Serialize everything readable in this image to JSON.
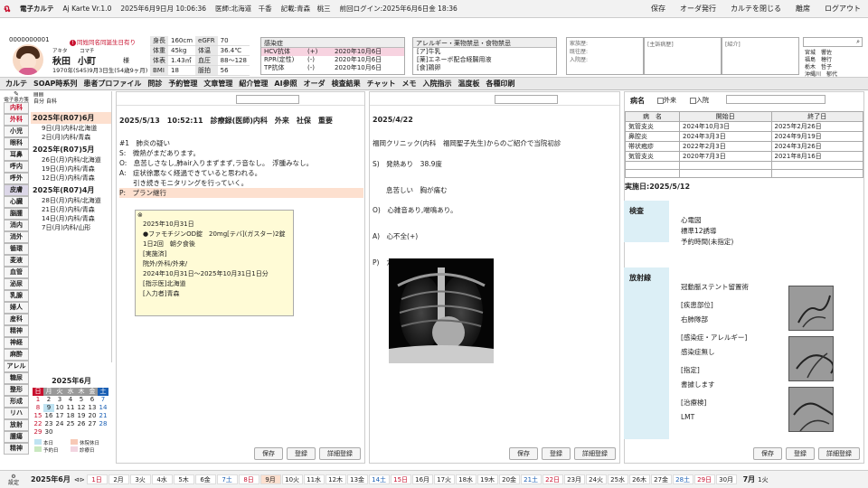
{
  "topbar": {
    "app_name": "電子カルテ",
    "version": "Aj Karte Vr.1.0",
    "datetime": "2025年6月9日月 10:06:36",
    "doctor": "医師:北海道　千香",
    "recorder": "記載:青森　桃三",
    "last_login": "前回ログイン:2025年6月6日金 18:36",
    "zoom": "100%",
    "help": "操作",
    "menu": [
      "保存",
      "オーダ発行",
      "カルテを閉じる",
      "離席",
      "ログアウト"
    ]
  },
  "patient": {
    "id": "0000000001",
    "alert": "同姓同名同誕生日有り",
    "kana_last": "アキタ",
    "kana_first": "コマチ",
    "name_last": "秋田",
    "name_first": "小町",
    "honorific": "様",
    "birth": "1970年(S45)9月3日生(54歳9ヶ月)",
    "sex_symbol": "女",
    "vitals": [
      [
        "身長",
        "160cm",
        "eGFR",
        "70"
      ],
      [
        "体重",
        "45kg",
        "体温",
        "36.4℃"
      ],
      [
        "体表",
        "1.43㎡",
        "血圧",
        "88～128"
      ],
      [
        "BMI",
        "18",
        "脈拍",
        "56"
      ]
    ]
  },
  "infection": {
    "title": "感染症",
    "rows": [
      [
        "HCV抗体",
        "(+)",
        "2020年10月6日"
      ],
      [
        "RPR(定性)",
        "(-)",
        "2020年10月6日"
      ],
      [
        "TP抗体",
        "(-)",
        "2020年10月6日"
      ]
    ]
  },
  "allergy": {
    "title": "アレルギー・薬物禁忌・食物禁忌",
    "rows": [
      "[ア]牛乳",
      "[薬]エネーボ配合経腸用液",
      "[食]鶏卵"
    ]
  },
  "history": {
    "labels": [
      "家族歴:",
      "既往歴:",
      "入院歴:"
    ],
    "main_title": "[主訴病歴]",
    "intro_title": "[紹介]"
  },
  "staff": [
    "宮城　響佐",
    "福島　穂行",
    "栃木　哲子",
    "沖縄川　郁代"
  ],
  "tabs": [
    "カルテ",
    "SOAP時系列",
    "患者プロファイル",
    "問診",
    "予約管理",
    "文章管理",
    "紹介管理",
    "AI参照",
    "オーダ",
    "検査結果",
    "チャット",
    "メモ",
    "入院指示",
    "温度板",
    "各種印刷"
  ],
  "leftnav": {
    "header": "電子患方箋",
    "items": [
      "内科",
      "外科",
      "小児",
      "眼科",
      "耳鼻",
      "呼内",
      "呼外",
      "皮膚",
      "心臓",
      "脳腫",
      "消内",
      "消外",
      "循環",
      "麦液",
      "血管",
      "泌尿",
      "乳腺",
      "婦人",
      "産科",
      "精神",
      "神経",
      "麻酔",
      "アレル",
      "糖尿",
      "整形",
      "形成",
      "リハ",
      "放射",
      "腫瘍",
      "精神"
    ],
    "selected": "皮膚"
  },
  "visits": {
    "filters": [
      "自分",
      "自科"
    ],
    "months": [
      {
        "label": "2025年(R07)6月",
        "days": [
          "9日(月)内科/北海道",
          "2日(月)内科/青森"
        ],
        "selected": true
      },
      {
        "label": "2025年(R07)5月",
        "days": [
          "26日(月)内科/北海道",
          "19日(月)内科/青森",
          "12日(月)内科/青森"
        ],
        "selected": false
      },
      {
        "label": "2025年(R07)4月",
        "days": [
          "28日(月)内科/北海道",
          "21日(月)内科/青森",
          "14日(月)内科/青森",
          "7日(月)内科/山形"
        ],
        "selected": false
      }
    ]
  },
  "calendar": {
    "title": "2025年6月",
    "weekdays": [
      "日",
      "月",
      "火",
      "水",
      "木",
      "金",
      "土"
    ],
    "days": [
      "1",
      "2",
      "3",
      "4",
      "5",
      "6",
      "7",
      "8",
      "9",
      "10",
      "11",
      "12",
      "13",
      "14",
      "15",
      "16",
      "17",
      "18",
      "19",
      "20",
      "21",
      "22",
      "23",
      "24",
      "25",
      "26",
      "27",
      "28",
      "29",
      "30"
    ],
    "legend": [
      "本日",
      "休院休日",
      "予約日",
      "診療日"
    ]
  },
  "note1": {
    "header": "2025/5/13　10:52:11　診療録(医師)内科　外来　社保　重要",
    "lines": [
      "#1　肺炎の疑い",
      "S:　微熱がまだあります。",
      "O:　息苦しさなし,肺air入りまずまず,ラ音なし。　浮腫みなし。",
      "A:　症状徐悪なく経過できていると思われる。",
      "　　引き続きモニタリングを行っていく。",
      "P:　プラン継行"
    ],
    "popup": [
      "2025年10月31日",
      "●ファモチジンOD錠　20mg[テバ](ガスター)2錠",
      "1日2回　朝夕食後",
      "[実施済]",
      "院外/外科/外来/",
      "2024年10月31日～2025年10月31日1日分",
      "[指示医]北海道",
      "[入力者]青森"
    ],
    "buttons": [
      "保存",
      "登録",
      "詳細登録"
    ]
  },
  "note2": {
    "header": "2025/4/22",
    "intro": "福岡クリニック(内科　福岡聖子先生)からのご紹介で当院初診",
    "lines": [
      "S)　発熱あり　38.9度",
      "　　息苦しい　胸が痛む",
      "O)　心雑音あり,喘鳴あり。",
      "A)　心不全(+)",
      "P)　カテーテル検査"
    ],
    "buttons": [
      "保存",
      "登録",
      "詳細登録"
    ]
  },
  "disease": {
    "title": "病名",
    "checks": [
      "外来",
      "入院"
    ],
    "headers": [
      "病　名",
      "開始日",
      "終了日"
    ],
    "rows": [
      [
        "気管支炎",
        "2024年10月3日",
        "2025年2月26日"
      ],
      [
        "鼻腔炎",
        "2024年3月3日",
        "2024年9月19日"
      ],
      [
        "帯状疱疹",
        "2022年2月3日",
        "2024年3月26日"
      ],
      [
        "気管支炎",
        "2020年7月3日",
        "2021年8月16日"
      ]
    ]
  },
  "exec": {
    "title": "実施日:2025/5/12",
    "kensa_label": "検査",
    "kensa_items": [
      "心電図",
      "標準12誘導",
      "予約時間(未指定)"
    ],
    "rad_label": "放射線",
    "rad_items": [
      "冠動脈ステント留置術",
      "[疾患部位]",
      "右肺隊部",
      "[感染症・アレルギー]",
      "感染症無し",
      "[指定]",
      "書據します",
      "[治療検]",
      "LMT"
    ],
    "buttons": [
      "保存",
      "登録",
      "詳細登録"
    ]
  },
  "bottom": {
    "month": "2025年6月",
    "days": [
      "1日",
      "2月",
      "3火",
      "4水",
      "5木",
      "6金",
      "7土",
      "8日",
      "9月",
      "10火",
      "11水",
      "12木",
      "13金",
      "14土",
      "15日",
      "16月",
      "17火",
      "18水",
      "19木",
      "20金",
      "21土",
      "22日",
      "23月",
      "24火",
      "25水",
      "26木",
      "27金",
      "28土",
      "29日",
      "30月"
    ],
    "next": "7月",
    "next_day": "1火",
    "settings": "設定"
  }
}
